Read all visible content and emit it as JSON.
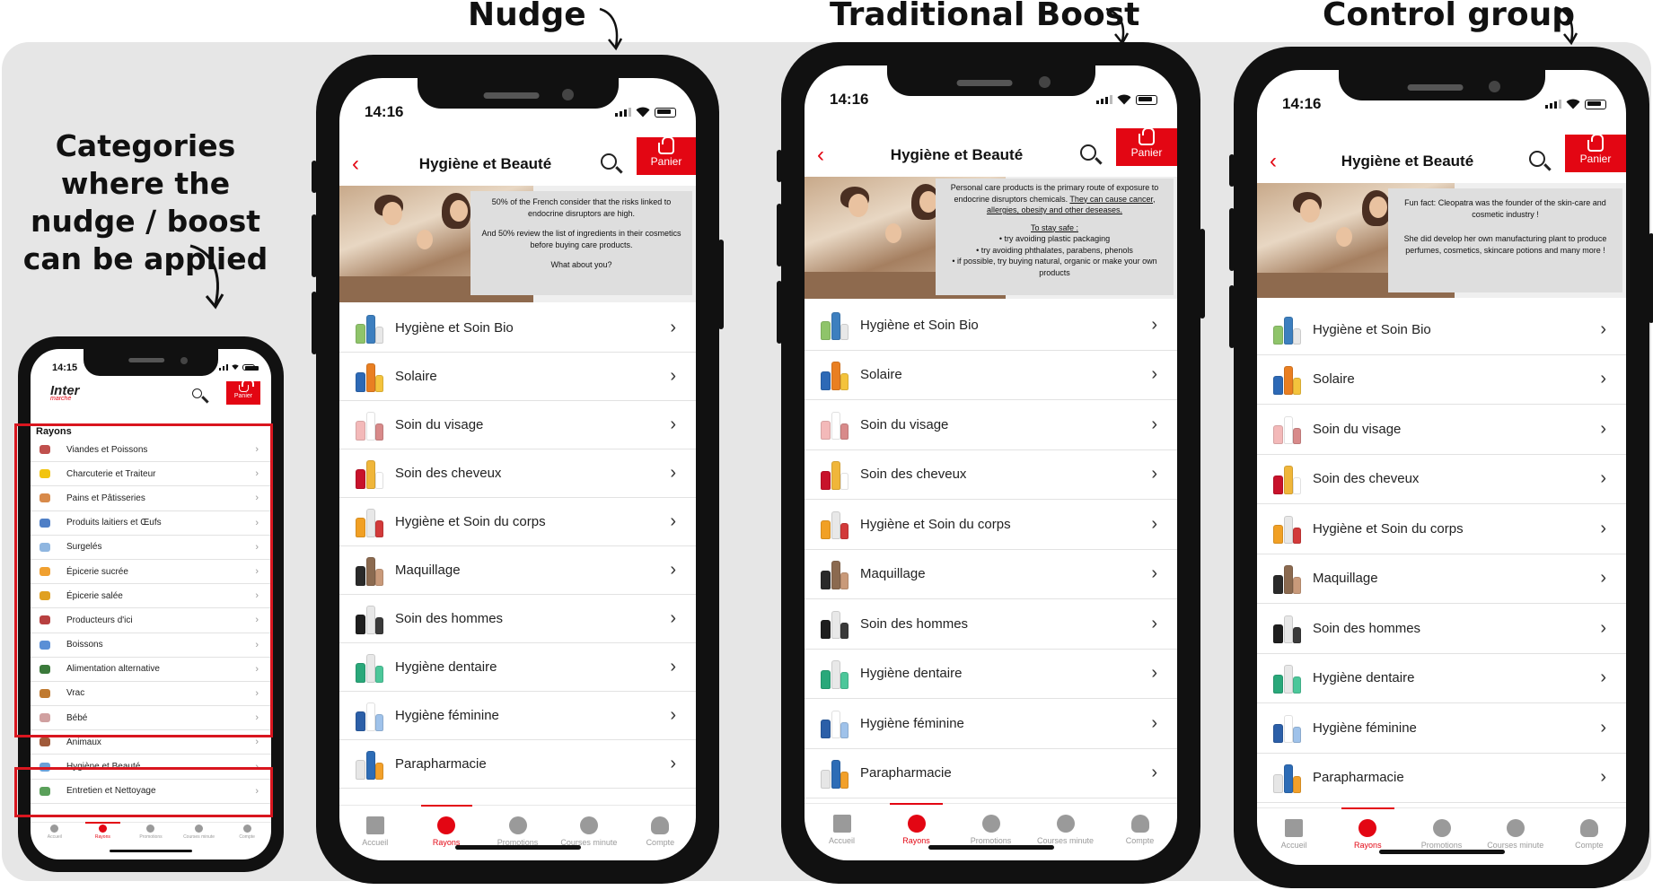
{
  "headlines": {
    "nudge": "Nudge",
    "traditional": "Traditional Boost",
    "control": "Control group"
  },
  "categories_note": "Categories where the nudge / boost can be applied",
  "colors": {
    "accent": "#e30613",
    "backdrop": "#e6e6e6"
  },
  "small_phone": {
    "time": "14:15",
    "logo": "Inter",
    "logo_sub": "marché",
    "panier": "Panier",
    "section_title": "Rayons",
    "items": [
      {
        "label": "Viandes et Poissons",
        "icon": "meat-icon",
        "color": "#c0504d"
      },
      {
        "label": "Charcuterie et Traiteur",
        "icon": "cheese-icon",
        "color": "#f2c40f"
      },
      {
        "label": "Pains et Pâtisseries",
        "icon": "bread-icon",
        "color": "#d88a4a"
      },
      {
        "label": "Produits laitiers et Œufs",
        "icon": "milk-icon",
        "color": "#4f7fc6"
      },
      {
        "label": "Surgelés",
        "icon": "snowflake-icon",
        "color": "#8fb6e0"
      },
      {
        "label": "Épicerie sucrée",
        "icon": "candy-icon",
        "color": "#f0a030"
      },
      {
        "label": "Épicerie salée",
        "icon": "jar-icon",
        "color": "#e0a020"
      },
      {
        "label": "Producteurs d'ici",
        "icon": "basket-icon",
        "color": "#b84040"
      },
      {
        "label": "Boissons",
        "icon": "bottle-icon",
        "color": "#5a8fd6"
      },
      {
        "label": "Alimentation alternative",
        "icon": "leaf-icon",
        "color": "#3b7a3b"
      },
      {
        "label": "Vrac",
        "icon": "bulk-jar-icon",
        "color": "#c07a30"
      },
      {
        "label": "Bébé",
        "icon": "baby-bottle-icon",
        "color": "#d0a0a0"
      },
      {
        "label": "Animaux",
        "icon": "bone-icon",
        "color": "#a05a3a"
      },
      {
        "label": "Hygiène et Beauté",
        "icon": "soap-icon",
        "color": "#6aa0d8"
      },
      {
        "label": "Entretien et Nettoyage",
        "icon": "spray-icon",
        "color": "#5aa05a"
      }
    ],
    "tabs": [
      "Accueil",
      "Rayons",
      "Promotions",
      "Courses minute",
      "Compte"
    ]
  },
  "phone_common": {
    "time": "14:16",
    "title": "Hygiène et Beauté",
    "panier": "Panier",
    "items": [
      "Hygiène et Soin Bio",
      "Solaire",
      "Soin du visage",
      "Soin des cheveux",
      "Hygiène et Soin du corps",
      "Maquillage",
      "Soin des hommes",
      "Hygiène dentaire",
      "Hygiène féminine",
      "Parapharmacie"
    ],
    "tabs": [
      "Accueil",
      "Rayons",
      "Promotions",
      "Courses minute",
      "Compte"
    ]
  },
  "nudge_banner": {
    "p1": "50% of the French consider that the risks linked to endocrine disruptors are high.",
    "p2": "And 50% review the list of ingredients in their cosmetics before buying care products.",
    "p3": "What about you?"
  },
  "boost_banner": {
    "p1a": "Personal care products is the primary route of exposure to endocrine disruptors chemicals. ",
    "p1b": "They can cause cancer, allergies, obesity and other deseases.",
    "heading": "To stay safe :",
    "bullets": [
      "try avoiding plastic packaging",
      "try avoiding phthalates, parabens, phenols",
      "if possible, try buying natural, organic or make your own products"
    ]
  },
  "control_banner": {
    "p1": "Fun fact: Cleopatra was the founder of the skin-care and cosmetic industry !",
    "p2": "She did develop her own manufacturing plant to produce perfumes, cosmetics, skincare potions and many more !"
  }
}
